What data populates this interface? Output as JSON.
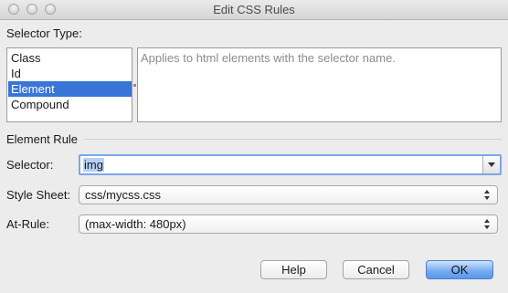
{
  "window": {
    "title": "Edit CSS Rules"
  },
  "selector_type": {
    "label": "Selector Type:",
    "items": [
      {
        "label": "Class",
        "selected": false
      },
      {
        "label": "Id",
        "selected": false
      },
      {
        "label": "Element",
        "selected": true
      },
      {
        "label": "Compound",
        "selected": false
      }
    ],
    "description": "Applies to html elements with the selector name."
  },
  "element_rule": {
    "section_label": "Element Rule",
    "selector": {
      "label": "Selector:",
      "value": "img"
    },
    "style_sheet": {
      "label": "Style Sheet:",
      "value": "css/mycss.css"
    },
    "at_rule": {
      "label": "At-Rule:",
      "value": "(max-width: 480px)"
    }
  },
  "buttons": {
    "help": "Help",
    "cancel": "Cancel",
    "ok": "OK"
  },
  "colors": {
    "selection": "#3875d7",
    "focus_ring": "#7aa7e8",
    "default_button": "#5b98ea"
  },
  "icons": [
    "close-icon",
    "minimize-icon",
    "zoom-icon",
    "chevron-down-icon",
    "up-down-arrows-icon"
  ]
}
